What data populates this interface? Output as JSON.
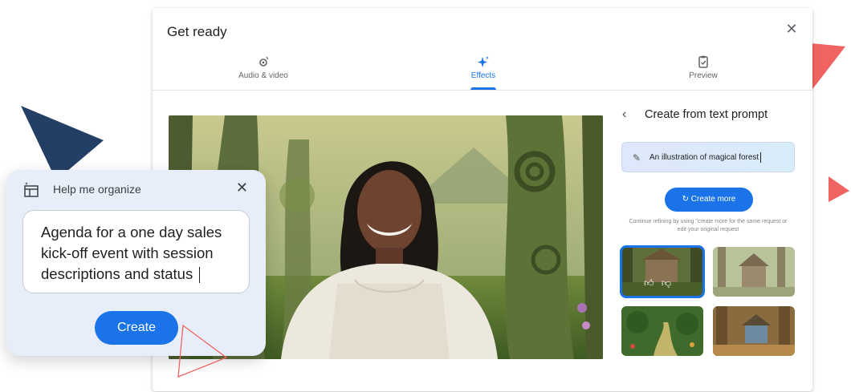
{
  "dialog": {
    "title": "Get ready",
    "close_icon": "close-icon"
  },
  "tabs": [
    {
      "label": "Audio & video",
      "icon": "audio-video-gear-icon",
      "active": false
    },
    {
      "label": "Effects",
      "icon": "sparkle-icon",
      "active": true
    },
    {
      "label": "Preview",
      "icon": "clipboard-check-icon",
      "active": false
    }
  ],
  "panel": {
    "heading": "Create from text prompt",
    "prompt_value": "An illustration of magical forest",
    "create_more_label": "Create more",
    "hint": "Continue refining by using \"create more for the same request or edit your original request"
  },
  "organize": {
    "title": "Help me organize",
    "input_value": "Agenda for a one day sales kick-off event with session descriptions and status",
    "create_label": "Create"
  },
  "colors": {
    "accent": "#1a73e8",
    "coral": "#f0615f",
    "navy": "#243f66"
  }
}
